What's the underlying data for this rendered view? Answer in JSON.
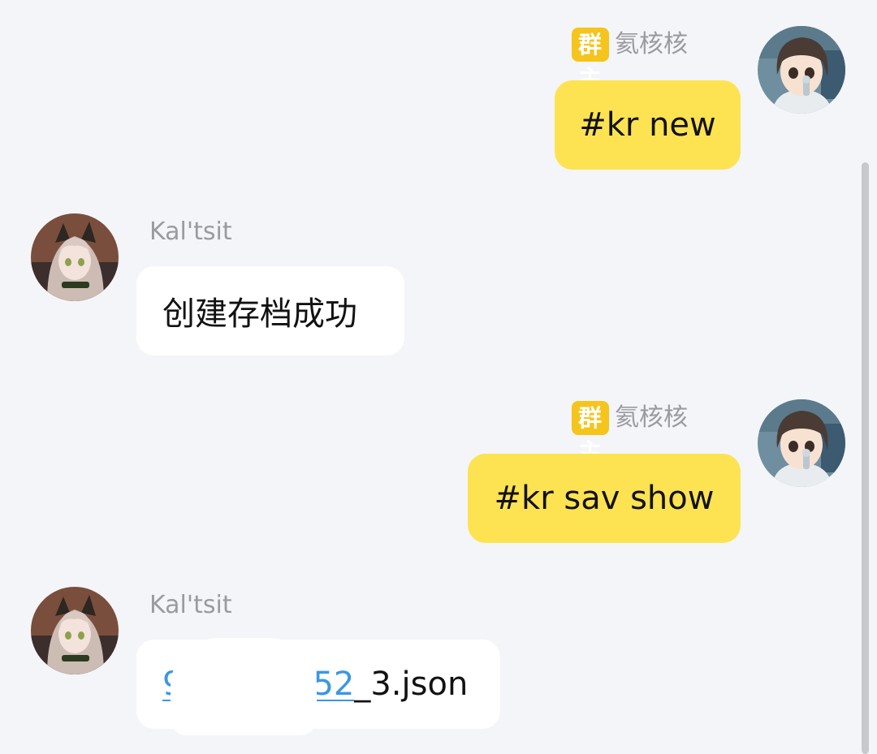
{
  "messages": [
    {
      "direction": "outgoing",
      "sender": {
        "role_badge": "群主",
        "name": "氦核核",
        "avatar": "avatar-brown-hair-girl"
      },
      "text": "#kr new"
    },
    {
      "direction": "incoming",
      "sender": {
        "name": "Kal'tsit",
        "avatar": "avatar-kaltsit"
      },
      "text": "创建存档成功"
    },
    {
      "direction": "outgoing",
      "sender": {
        "role_badge": "群主",
        "name": "氦核核",
        "avatar": "avatar-brown-hair-girl"
      },
      "text": "#kr sav show"
    },
    {
      "direction": "incoming",
      "sender": {
        "name": "Kal'tsit",
        "avatar": "avatar-kaltsit"
      },
      "file": {
        "link_text_start": "9",
        "link_text_end": "52",
        "rest_text": "_3.json"
      }
    }
  ],
  "colors": {
    "background": "#f4f5f9",
    "outgoing_bubble": "#fde352",
    "incoming_bubble": "#ffffff",
    "role_badge": "#f5c41d",
    "link": "#3b97e3"
  }
}
